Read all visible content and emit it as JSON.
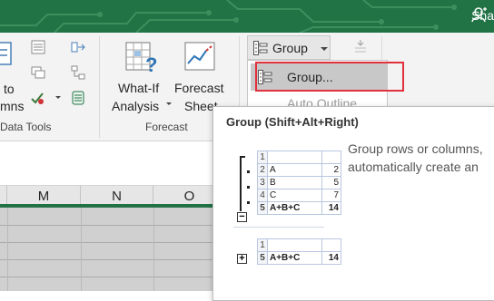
{
  "titlebar": {
    "share_label": "Sha",
    "bg_color": "#217346"
  },
  "ribbon": {
    "data_tools": {
      "to_label": "to",
      "columns_label": "mns",
      "group_label": "Data Tools"
    },
    "forecast": {
      "whatif_line1": "What-If",
      "whatif_line2": "Analysis",
      "sheet_line1": "Forecast",
      "sheet_line2": "Sheet",
      "group_label": "Forecast"
    },
    "outline": {
      "group_button_label": "Group"
    }
  },
  "menu": {
    "items": [
      {
        "label": "Group...",
        "highlighted": true
      },
      {
        "label": "Auto Outline",
        "highlighted": false
      }
    ]
  },
  "columns": [
    "M",
    "N",
    "O"
  ],
  "tooltip": {
    "title": "Group (Shift+Alt+Right)",
    "description_line1": "Group rows or columns,",
    "description_line2": "automatically create an",
    "example_grouped": [
      {
        "row": "1",
        "label": "",
        "value": ""
      },
      {
        "row": "2",
        "label": "A",
        "value": "2"
      },
      {
        "row": "3",
        "label": "B",
        "value": "5"
      },
      {
        "row": "4",
        "label": "C",
        "value": "7"
      },
      {
        "row": "5",
        "label": "A+B+C",
        "value": "14"
      }
    ],
    "example_collapsed": [
      {
        "row": "1",
        "label": "",
        "value": ""
      },
      {
        "row": "5",
        "label": "A+B+C",
        "value": "14"
      }
    ],
    "minus_symbol": "−",
    "plus_symbol": "+"
  },
  "colors": {
    "accent": "#217346",
    "highlight_box": "#e0313c",
    "menu_hover": "#c8c8c8"
  }
}
